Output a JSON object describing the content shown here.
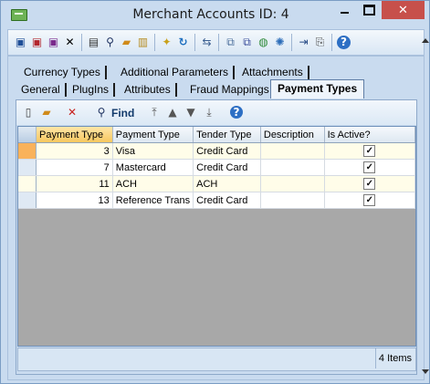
{
  "window": {
    "title": "Merchant Accounts ID: 4",
    "controls": {
      "minimize": "minimize",
      "maximize": "maximize",
      "close": "✕"
    }
  },
  "toolbar": {
    "icons": [
      "save-icon",
      "save-close-icon",
      "save-new-icon",
      "delete-icon",
      "print-icon",
      "find-icon",
      "open-folder-icon",
      "notes-icon",
      "wand-icon",
      "refresh-icon",
      "link-icon",
      "copy-icon",
      "duplicate-icon",
      "globe-icon",
      "settings-icon",
      "goto-icon",
      "export-icon",
      "help-icon"
    ]
  },
  "tabs": {
    "row1": [
      "Currency Types",
      "Additional Parameters",
      "Attachments"
    ],
    "row2": [
      "General",
      "PlugIns",
      "Attributes",
      "Fraud Mappings",
      "Payment Types"
    ],
    "active": "Payment Types"
  },
  "subtoolbar": {
    "find_label": "Find"
  },
  "grid": {
    "columns": [
      "Payment Type",
      "Payment Type",
      "Tender Type",
      "Description",
      "Is Active?"
    ],
    "rows": [
      {
        "id": "3",
        "name": "Visa",
        "tender": "Credit Card",
        "description": "",
        "active": true
      },
      {
        "id": "7",
        "name": "Mastercard",
        "tender": "Credit Card",
        "description": "",
        "active": true
      },
      {
        "id": "11",
        "name": "ACH",
        "tender": "ACH",
        "description": "",
        "active": true
      },
      {
        "id": "13",
        "name": "Reference Trans",
        "tender": "Credit Card",
        "description": "",
        "active": true
      }
    ]
  },
  "status": {
    "count": "4 Items"
  },
  "colors": {
    "window_bg": "#c9dbef",
    "close_button": "#c7504b",
    "selected_row_marker": "#f9b25a",
    "sorted_header": "#f7c75f"
  }
}
